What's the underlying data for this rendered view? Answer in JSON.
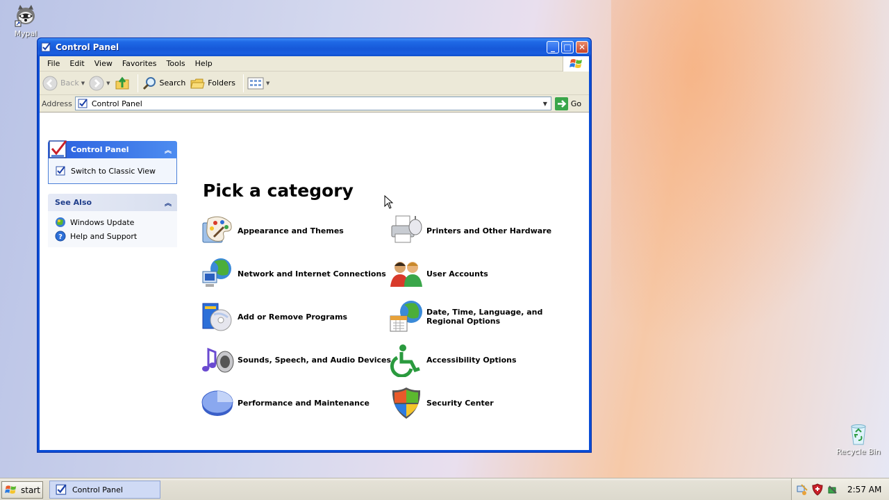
{
  "desktop": {
    "icons": [
      {
        "label": "Mypal",
        "icon": "mypal-raccoon-icon"
      },
      {
        "label": "Recycle Bin",
        "icon": "recycle-bin-icon"
      }
    ]
  },
  "window": {
    "title": "Control Panel",
    "controls": {
      "minimize": "_",
      "maximize": "□",
      "close": "✕"
    }
  },
  "menu": [
    "File",
    "Edit",
    "View",
    "Favorites",
    "Tools",
    "Help"
  ],
  "toolbar": {
    "back_label": "Back",
    "search_label": "Search",
    "folders_label": "Folders"
  },
  "address": {
    "label": "Address",
    "value": "Control Panel",
    "go_label": "Go"
  },
  "sidebar": {
    "primary": {
      "title": "Control Panel",
      "links": [
        {
          "label": "Switch to Classic View",
          "icon": "control-panel-icon"
        }
      ]
    },
    "see_also": {
      "title": "See Also",
      "links": [
        {
          "label": "Windows Update",
          "icon": "windows-update-icon"
        },
        {
          "label": "Help and Support",
          "icon": "help-icon"
        }
      ]
    }
  },
  "main": {
    "heading": "Pick a category",
    "categories": [
      {
        "label": "Appearance and Themes",
        "icon": "appearance-themes-icon"
      },
      {
        "label": "Printers and Other Hardware",
        "icon": "printer-icon"
      },
      {
        "label": "Network and Internet Connections",
        "icon": "network-icon"
      },
      {
        "label": "User Accounts",
        "icon": "user-accounts-icon"
      },
      {
        "label": "Add or Remove Programs",
        "icon": "add-remove-programs-icon"
      },
      {
        "label": "Date, Time, Language, and Regional Options",
        "icon": "date-time-globe-icon"
      },
      {
        "label": "Sounds, Speech, and Audio Devices",
        "icon": "sound-icon"
      },
      {
        "label": "Accessibility Options",
        "icon": "accessibility-icon"
      },
      {
        "label": "Performance and Maintenance",
        "icon": "performance-icon"
      },
      {
        "label": "Security Center",
        "icon": "security-shield-icon"
      }
    ]
  },
  "taskbar": {
    "start_label": "start",
    "items": [
      {
        "label": "Control Panel"
      }
    ],
    "clock": "2:57 AM"
  },
  "colors": {
    "title_blue": "#1658d8",
    "panel_blue": "#2a5fde",
    "taskbar": "#dcd9cd"
  }
}
